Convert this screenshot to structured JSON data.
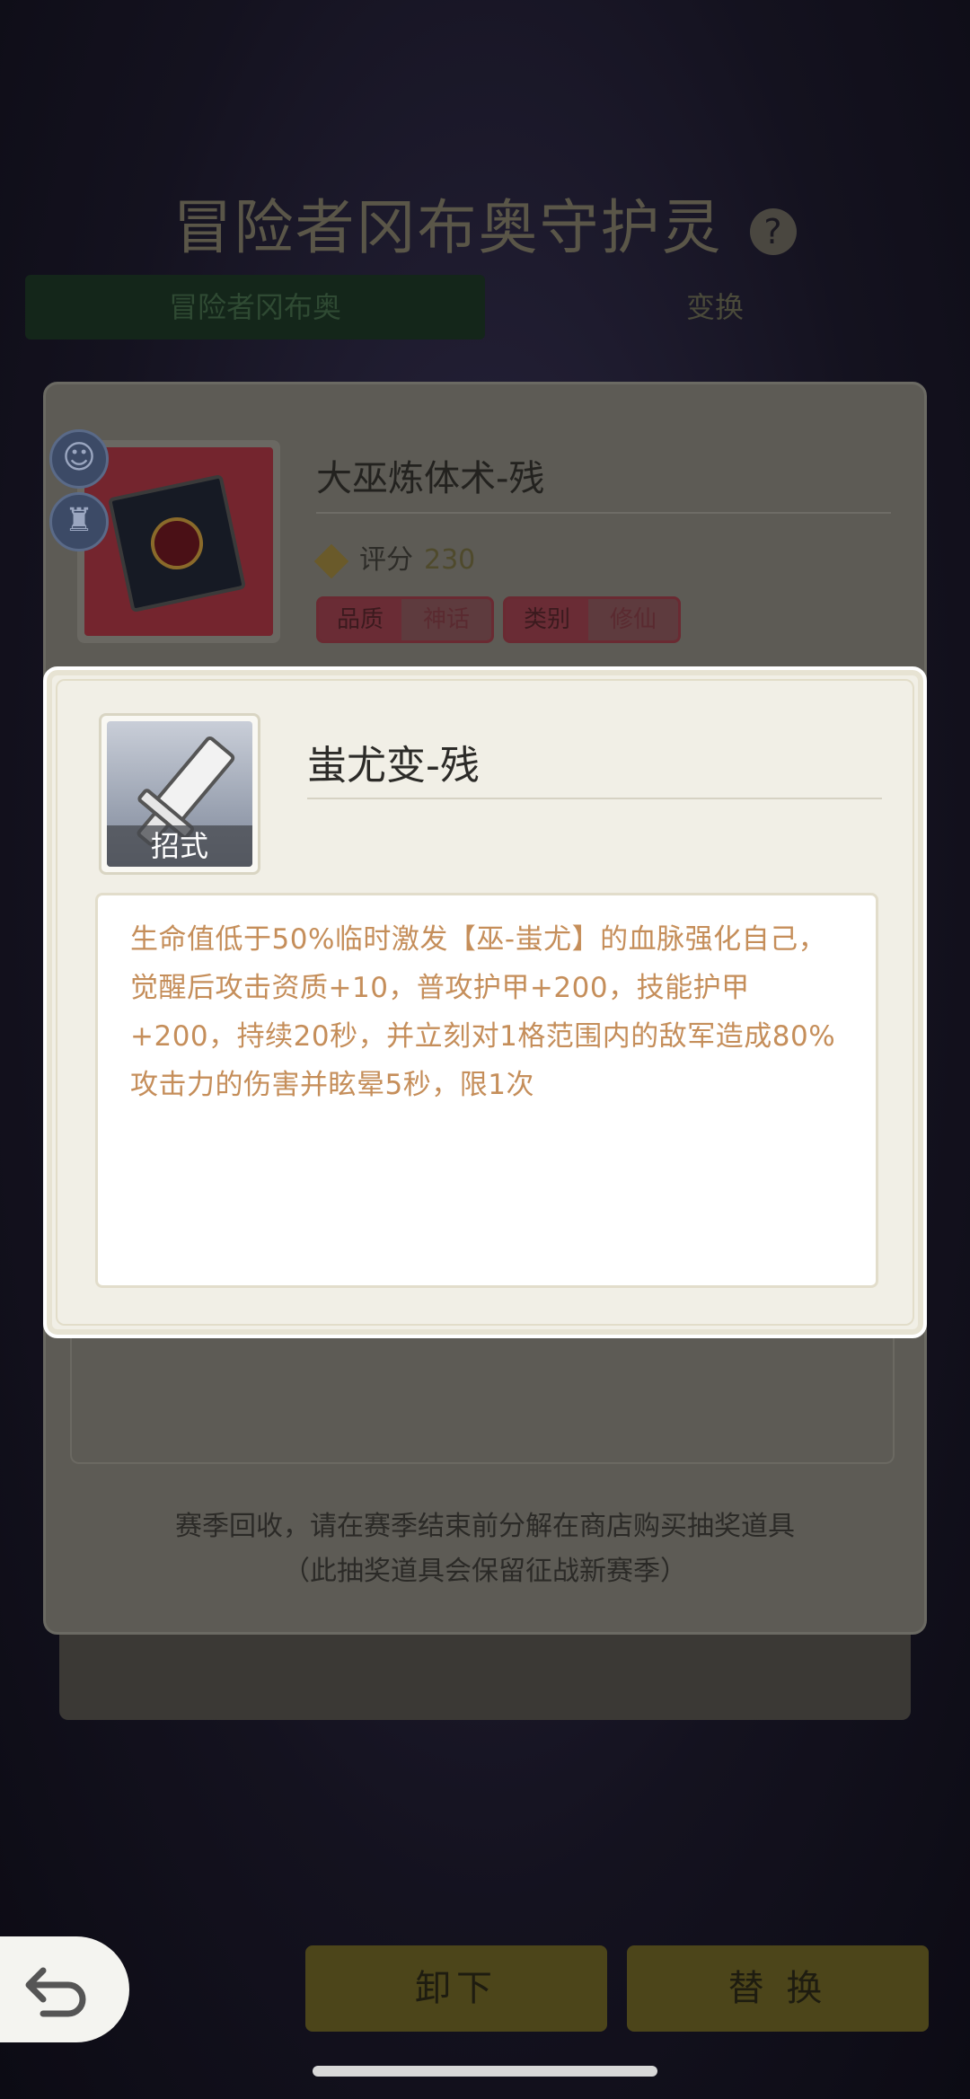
{
  "background": {
    "page_title": "冒险者冈布奥守护灵",
    "help_glyph": "?",
    "tabs": [
      {
        "label": "冒险者冈布奥"
      },
      {
        "label": "变换"
      }
    ],
    "item": {
      "name": "大巫炼体术-残",
      "score_label": "评分",
      "score_value": "230",
      "quality_key": "品质",
      "quality_value": "神话",
      "category_key": "类别",
      "category_value": "修仙"
    },
    "notice_line1": "赛季回收，请在赛季结束前分解在商店购买抽奖道具",
    "notice_line2": "（此抽奖道具会保留征战新赛季）"
  },
  "buttons": {
    "unequip": "卸下",
    "replace": "替 换"
  },
  "modal": {
    "skill_type_badge": "招式",
    "skill_name": "蚩尤变-残",
    "description": "生命值低于50%临时激发【巫-蚩尤】的血脉强化自己，觉醒后攻击资质+10，普攻护甲+200，技能护甲+200，持续20秒，并立刻对1格范围内的敌军造成80%攻击力的伤害并眩晕5秒，限1次"
  },
  "icons": {
    "back": "back-arrow-icon",
    "side_top": "gumball-icon",
    "side_bottom": "castle-icon",
    "score": "gem-icon",
    "skill": "sword-icon"
  },
  "colors": {
    "description_text": "#c58e5a",
    "modal_background": "#f1efe6"
  }
}
